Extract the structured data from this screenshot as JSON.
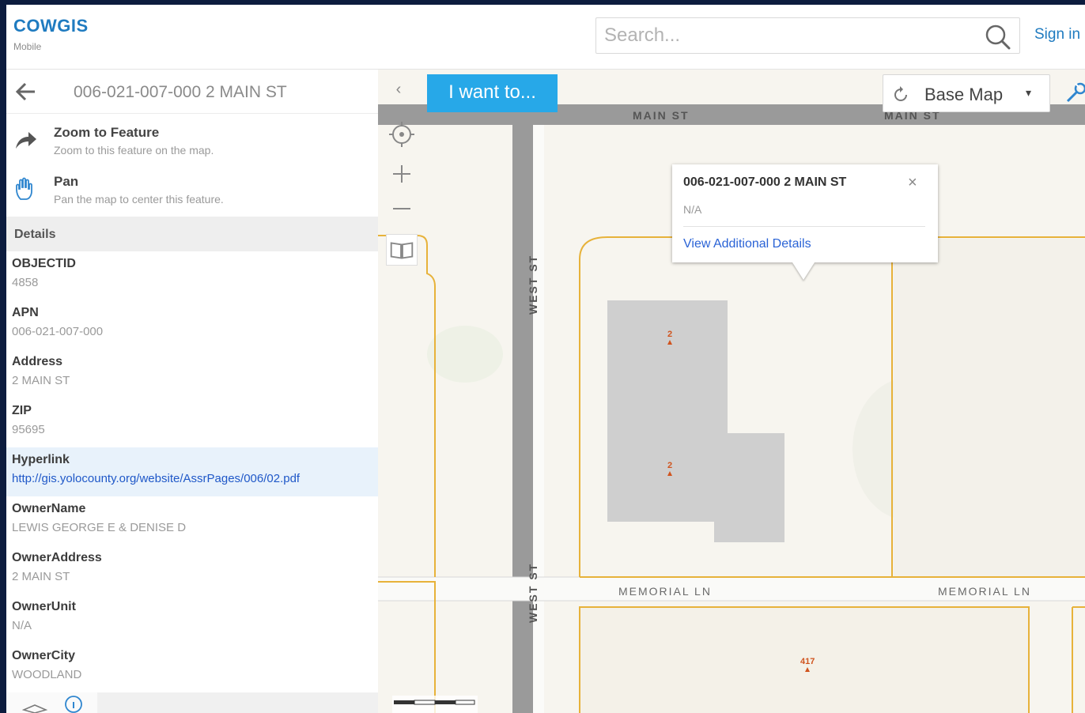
{
  "app": {
    "logo": "COWGIS",
    "logo_sub": "Mobile"
  },
  "search": {
    "placeholder": "Search..."
  },
  "header": {
    "signin_label": "Sign in"
  },
  "panel": {
    "title": "006-021-007-000 2 MAIN ST",
    "actions": [
      {
        "title": "Zoom to Feature",
        "desc": "Zoom to this feature on the map.",
        "icon": "share-arrow-icon"
      },
      {
        "title": "Pan",
        "desc": "Pan the map to center this feature.",
        "icon": "hand-icon"
      }
    ],
    "details_label": "Details",
    "fields": [
      {
        "name": "OBJECTID",
        "value": "4858"
      },
      {
        "name": "APN",
        "value": "006-021-007-000"
      },
      {
        "name": "Address",
        "value": "2 MAIN ST"
      },
      {
        "name": "ZIP",
        "value": "95695"
      },
      {
        "name": "Hyperlink",
        "value": "http://gis.yolocounty.org/website/AssrPages/006/02.pdf"
      },
      {
        "name": "OwnerName",
        "value": "LEWIS GEORGE E & DENISE D"
      },
      {
        "name": "OwnerAddress",
        "value": "2 MAIN ST"
      },
      {
        "name": "OwnerUnit",
        "value": "N/A"
      },
      {
        "name": "OwnerCity",
        "value": "WOODLAND"
      }
    ]
  },
  "map": {
    "iwant_label": "I want to...",
    "collapse_label": "‹",
    "basemap_label": "Base Map",
    "basemap_caret": "▾",
    "streets": {
      "main_st": "MAIN ST",
      "main_st_2": "MAIN ST",
      "west_st": "WEST ST",
      "west_st_2": "WEST ST",
      "memorial_ln": "MEMORIAL LN",
      "memorial_ln_2": "MEMORIAL LN"
    },
    "parcel_labels": [
      "2",
      "2",
      "417"
    ],
    "popup": {
      "title": "006-021-007-000 2 MAIN ST",
      "close": "×",
      "value": "N/A",
      "link": "View Additional Details"
    }
  },
  "colors": {
    "brand": "#1f7bc0",
    "iwant_bg": "#27a8e8",
    "link": "#1f58c8",
    "parcel_line": "#e7b23a"
  }
}
